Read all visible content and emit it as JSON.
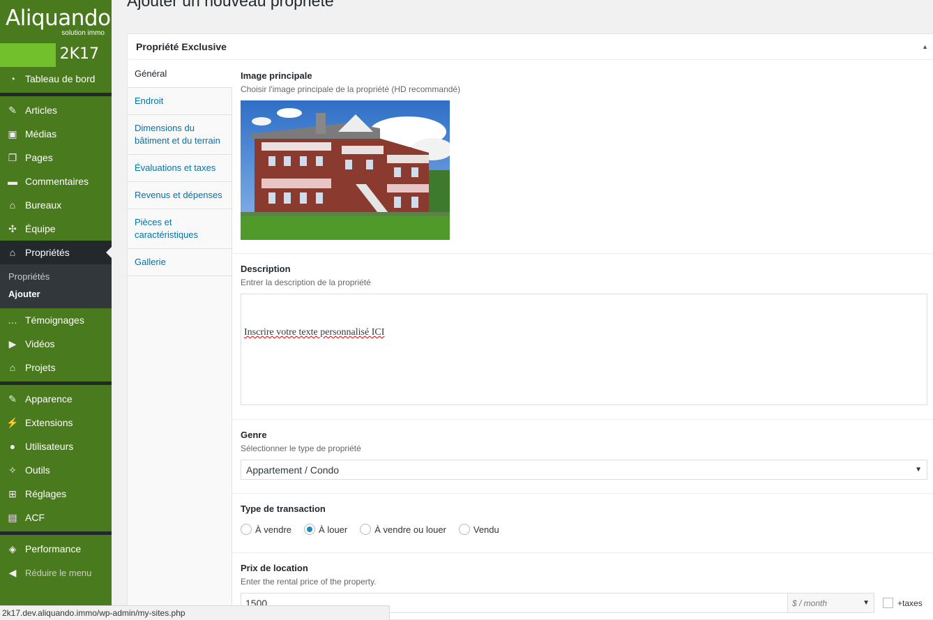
{
  "brand": {
    "logo_text": "Aliquando",
    "logo_sub": "solution immo",
    "version": "2K17",
    "accent": "#72c02c",
    "sidebar_bg": "#4a7a1e"
  },
  "sidebar": {
    "group1": [
      {
        "label": "Tableau de bord",
        "icon": "dashboard-icon",
        "glyph": "◔"
      }
    ],
    "group2": [
      {
        "label": "Articles",
        "icon": "pin-icon",
        "glyph": "✎"
      },
      {
        "label": "Médias",
        "icon": "media-icon",
        "glyph": "▣"
      },
      {
        "label": "Pages",
        "icon": "pages-icon",
        "glyph": "❐"
      },
      {
        "label": "Commentaires",
        "icon": "comment-icon",
        "glyph": "▬"
      },
      {
        "label": "Bureaux",
        "icon": "building-icon",
        "glyph": "⌂"
      },
      {
        "label": "Équipe",
        "icon": "team-icon",
        "glyph": "✣"
      }
    ],
    "active": {
      "label": "Propriétés",
      "icon": "home-icon",
      "glyph": "⌂"
    },
    "submenu": [
      "Propriétés",
      "Ajouter"
    ],
    "group3": [
      {
        "label": "Témoignages",
        "icon": "testimonial-icon",
        "glyph": "…"
      },
      {
        "label": "Vidéos",
        "icon": "video-icon",
        "glyph": "▶"
      },
      {
        "label": "Projets",
        "icon": "project-icon",
        "glyph": "⌂"
      }
    ],
    "group4": [
      {
        "label": "Apparence",
        "icon": "brush-icon",
        "glyph": "✎"
      },
      {
        "label": "Extensions",
        "icon": "plugin-icon",
        "glyph": "⚡"
      },
      {
        "label": "Utilisateurs",
        "icon": "user-icon",
        "glyph": "●"
      },
      {
        "label": "Outils",
        "icon": "wrench-icon",
        "glyph": "✧"
      },
      {
        "label": "Réglages",
        "icon": "settings-icon",
        "glyph": "⊞"
      },
      {
        "label": "ACF",
        "icon": "acf-icon",
        "glyph": "▤"
      }
    ],
    "group5": [
      {
        "label": "Performance",
        "icon": "performance-icon",
        "glyph": "◈"
      }
    ],
    "collapse": {
      "label": "Réduire le menu",
      "icon": "collapse-icon",
      "glyph": "◀"
    }
  },
  "page": {
    "title": "Ajouter un nouveau propriété"
  },
  "box": {
    "title": "Propriété Exclusive"
  },
  "tabs": [
    "Général",
    "Endroit",
    "Dimensions du bâtiment et du terrain",
    "Évaluations et taxes",
    "Revenus et dépenses",
    "Pièces et caractéristiques",
    "Gallerie"
  ],
  "fields": {
    "image": {
      "label": "Image principale",
      "desc": "Choisir l'image principale de la propriété (HD recommandé)"
    },
    "description": {
      "label": "Description",
      "desc": "Entrer la description de la propriété",
      "value": "Inscrire votre texte personnalisé ICI"
    },
    "genre": {
      "label": "Genre",
      "desc": "Sélectionner le type de propriété",
      "value": "Appartement / Condo"
    },
    "transaction": {
      "label": "Type de transaction",
      "options": [
        "À vendre",
        "À louer",
        "À vendre ou louer",
        "Vendu"
      ],
      "selected": "À louer"
    },
    "price": {
      "label": "Prix de location",
      "desc": "Enter the rental price of the property.",
      "value": "1500",
      "unit": "$ / month",
      "taxes": "+taxes"
    }
  },
  "status": {
    "url": "2k17.dev.aliquando.immo/wp-admin/my-sites.php"
  }
}
